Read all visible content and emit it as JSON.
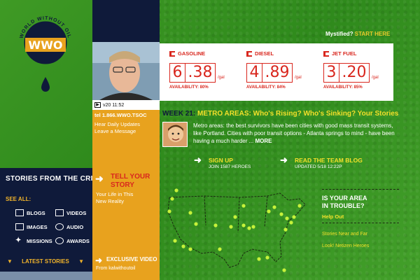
{
  "logo": {
    "arc_text": "WORLD WITHOUT OIL",
    "mark": "WWO"
  },
  "header": {
    "mystified": "Mystified?",
    "start_here": "START HERE"
  },
  "video": {
    "timestamp": "v20 11:52",
    "play_icon": "play-icon"
  },
  "phone": {
    "tel": "tel 1.866.WWO.TSOC",
    "hear_daily": "Hear Daily Updates",
    "leave_message": "Leave a Message"
  },
  "fuel": [
    {
      "name": "GASOLINE",
      "digits": [
        "6",
        ".38"
      ],
      "unit": "/gal",
      "availability": "AVAILABILITY: 80%"
    },
    {
      "name": "DIESEL",
      "digits": [
        "4",
        ".89"
      ],
      "unit": "/gal",
      "availability": "AVAILABILITY: 84%"
    },
    {
      "name": "JET FUEL",
      "digits": [
        "3",
        ".20"
      ],
      "unit": "/gal",
      "availability": "AVAILABILITY: 85%"
    }
  ],
  "week": {
    "label": "WEEK 21:",
    "title": "METRO AREAS: Who's Rising? Who's Sinking? Your Stories",
    "blurb": "Metro areas: the best survivors have been cities with good mass transit systems, like Portland. Cities with poor transit options - Atlanta springs to mind - have been having a much harder ...",
    "more": "MORE"
  },
  "cta": {
    "signup": "SIGN UP",
    "signup_sub": "JOIN 1587 HEROES",
    "blog": "READ THE TEAM BLOG",
    "blog_sub": "UPDATED 5/18 12:22P"
  },
  "stories": {
    "title": "STORIES FROM THE CRISIS",
    "see_all": "SEE ALL:",
    "items": [
      {
        "label": "BLOGS",
        "icon": "blog-icon"
      },
      {
        "label": "VIDEOS",
        "icon": "video-icon"
      },
      {
        "label": "IMAGES",
        "icon": "image-icon"
      },
      {
        "label": "AUDIO",
        "icon": "audio-icon"
      },
      {
        "label": "MISSIONS",
        "icon": "mission-icon"
      },
      {
        "label": "AWARDS",
        "icon": "award-icon"
      }
    ],
    "latest": "LATEST STORIES"
  },
  "tell": {
    "title_1": "TELL YOUR",
    "title_2": "STORY",
    "life_1": "Your Life in This",
    "life_2": "New Reality"
  },
  "exclusive": {
    "title": "EXCLUSIVE VIDEO",
    "sub": "From kalwithoutoil"
  },
  "trouble": {
    "title_1": "IS YOUR AREA",
    "title_2": "IN TROUBLE?",
    "help": "Help Out",
    "near": "Stories Near and Far",
    "netizen": "Look! Netizen Heroes"
  },
  "colors": {
    "navy": "#0f1a3a",
    "orange": "#e8a21e",
    "green": "#3a8f22",
    "red": "#d9271e",
    "yellow": "#f2e02a"
  }
}
